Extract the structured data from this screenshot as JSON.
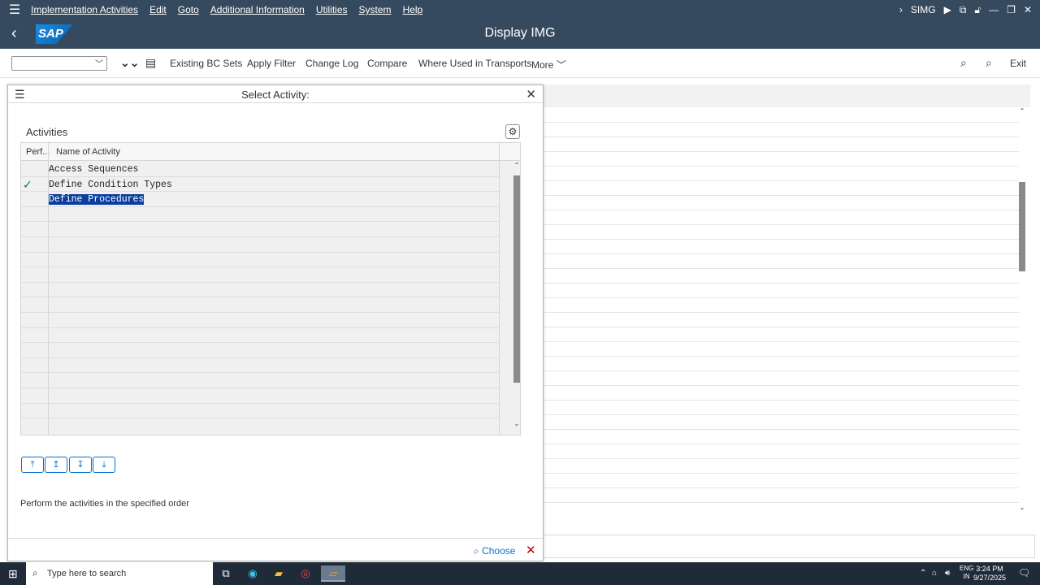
{
  "menubar": {
    "items": [
      "Implementation Activities",
      "Edit",
      "Goto",
      "Additional Information",
      "Utilities",
      "System",
      "Help"
    ],
    "system_id": "SIMG"
  },
  "titlebar": {
    "title": "Display IMG",
    "logo_text": "SAP"
  },
  "toolbar": {
    "existing_bc_sets": "Existing BC Sets",
    "apply_filter": "Apply Filter",
    "change_log": "Change Log",
    "compare": "Compare",
    "where_used": "Where Used in Transports",
    "more": "More",
    "exit": "Exit"
  },
  "dialog": {
    "title": "Select Activity:",
    "section_title": "Activities",
    "columns": {
      "perf": "Perf...",
      "name": "Name of Activity"
    },
    "rows": [
      {
        "name": "Access Sequences",
        "performed": false,
        "selected": false
      },
      {
        "name": "Define Condition Types",
        "performed": true,
        "selected": false
      },
      {
        "name": "Define Procedures",
        "performed": false,
        "selected": true
      }
    ],
    "check_glyph": "✓",
    "hint": "Perform the activities in the specified order",
    "choose": "Choose"
  },
  "taskbar": {
    "search_placeholder": "Type here to search",
    "lang_top": "ENG",
    "lang_bottom": "IN",
    "time": "3:24 PM",
    "date": "9/27/2025"
  }
}
